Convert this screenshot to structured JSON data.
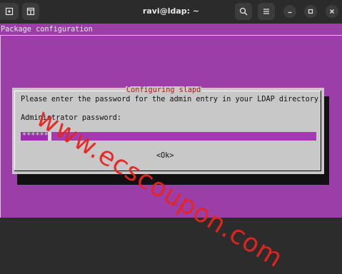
{
  "window": {
    "title": "ravi@ldap: ~"
  },
  "terminal": {
    "header_text": "Package configuration"
  },
  "dialog": {
    "title": "Configuring slapd",
    "message": "Please enter the password for the admin entry in your LDAP directory.",
    "field_label": "Administrator password:",
    "password_value": "******",
    "ok_label": "<Ok>"
  },
  "watermark": {
    "text": "www.ecscoupon.com"
  },
  "colors": {
    "terminal_bg": "#9b3ea8",
    "titlebar_bg": "#2b2b2b",
    "dialog_bg": "#c8c8c8",
    "dialog_title": "#b01818",
    "watermark": "#e8241e"
  },
  "icons": [
    "new-tab-icon",
    "split-view-icon",
    "search-icon",
    "hamburger-menu-icon",
    "minimize-icon",
    "maximize-icon",
    "close-icon"
  ]
}
